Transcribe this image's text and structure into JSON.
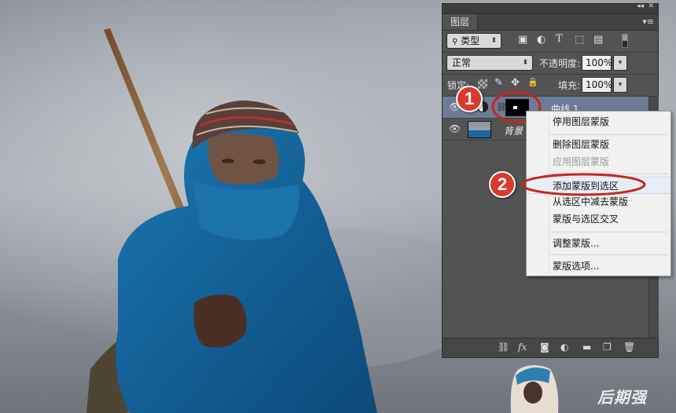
{
  "panel": {
    "tab_label": "图层",
    "filter_kind": "类型",
    "blend_mode": "正常",
    "opacity_label": "不透明度:",
    "opacity_value": "100%",
    "lock_label": "锁定:",
    "fill_label": "填充:",
    "fill_value": "100%",
    "layers": [
      {
        "name": "曲线 1",
        "selected": true
      },
      {
        "name": "背景",
        "selected": false
      }
    ]
  },
  "context_menu": {
    "items": [
      {
        "label": "停用图层蒙版",
        "enabled": true
      },
      {
        "label": "删除图层蒙版",
        "enabled": true
      },
      {
        "label": "应用图层蒙版",
        "enabled": false
      },
      {
        "label": "添加蒙版到选区",
        "enabled": true,
        "highlighted": true
      },
      {
        "label": "从选区中减去蒙版",
        "enabled": true
      },
      {
        "label": "蒙版与选区交叉",
        "enabled": true
      },
      {
        "label": "调整蒙版...",
        "enabled": true
      },
      {
        "label": "蒙版选项...",
        "enabled": true
      }
    ]
  },
  "annotations": {
    "step1": "1",
    "step2": "2",
    "color": "#d83a2e"
  },
  "watermark": "后期强",
  "icons": [
    "search-icon",
    "image-filter-icon",
    "adjustment-filter-icon",
    "type-filter-icon",
    "shape-filter-icon",
    "smart-object-filter-icon",
    "lock-transparent-icon",
    "lock-paint-icon",
    "lock-move-icon",
    "lock-all-icon",
    "eye-icon",
    "link-icon",
    "fx-icon",
    "mask-icon",
    "adjustment-icon",
    "folder-icon",
    "new-layer-icon",
    "trash-icon"
  ]
}
